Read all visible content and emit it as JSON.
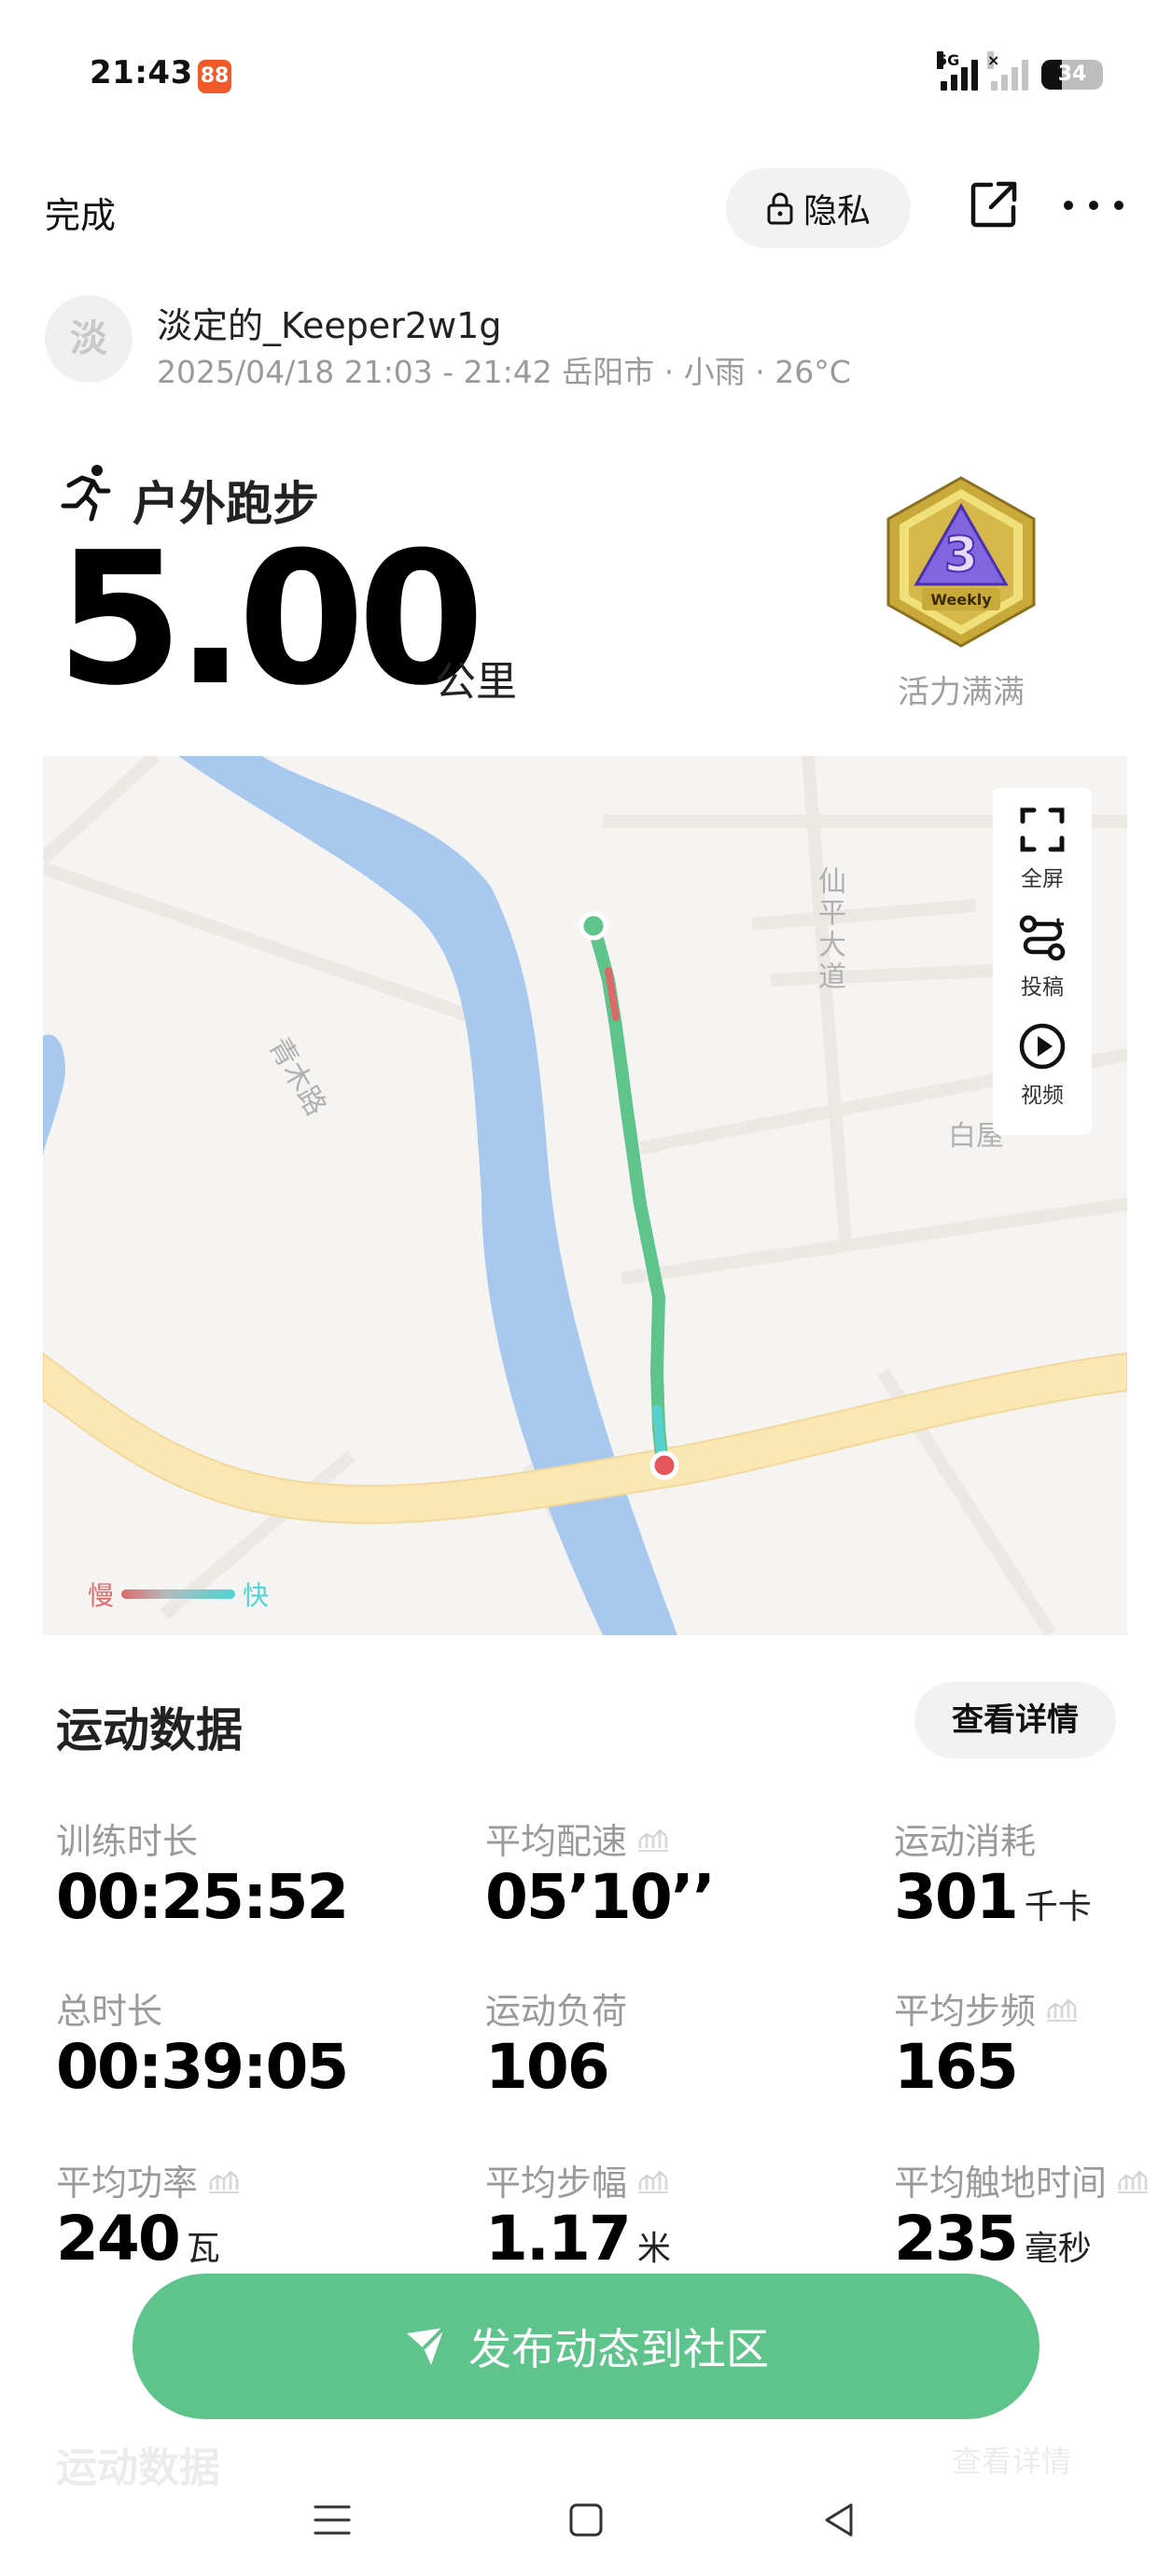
{
  "status_bar": {
    "time": "21:43",
    "app_icon_glyph": "88",
    "network_label": "5G",
    "second_sim_label": "×",
    "battery_level": "34"
  },
  "top_bar": {
    "done_label": "完成",
    "privacy_label": "隐私"
  },
  "user": {
    "avatar_char": "淡",
    "name": "淡定的_Keeper2w1g",
    "meta": "2025/04/18 21:03 - 21:42 岳阳市 · 小雨 · 26°C"
  },
  "activity": {
    "title": "户外跑步",
    "distance": "5.00",
    "distance_unit": "公里",
    "badge_text": "Weekly",
    "badge_label": "活力满满"
  },
  "map": {
    "labels": [
      "仙平大道",
      "白屋",
      "青木路"
    ],
    "controls": [
      {
        "label": "全屏",
        "icon": "fullscreen-icon"
      },
      {
        "label": "投稿",
        "icon": "route-icon"
      },
      {
        "label": "视频",
        "icon": "play-icon"
      }
    ],
    "legend_slow": "慢",
    "legend_fast": "快",
    "colors": {
      "river": "#a9c8ee",
      "road": "#fbe7b4",
      "route": "#5ec48c",
      "start": "#5ec48c",
      "end": "#e5565c"
    }
  },
  "stats": {
    "section_title": "运动数据",
    "detail_label": "查看详情",
    "items": [
      {
        "label": "训练时长",
        "value": "00:25:52",
        "unit": "",
        "chart": false
      },
      {
        "label": "平均配速",
        "value": "05’10’’",
        "unit": "",
        "chart": true
      },
      {
        "label": "运动消耗",
        "value": "301",
        "unit": "千卡",
        "chart": false
      },
      {
        "label": "总时长",
        "value": "00:39:05",
        "unit": "",
        "chart": false
      },
      {
        "label": "运动负荷",
        "value": "106",
        "unit": "",
        "chart": false
      },
      {
        "label": "平均步频",
        "value": "165",
        "unit": "",
        "chart": true
      },
      {
        "label": "平均功率",
        "value": "240",
        "unit": "瓦",
        "chart": true
      },
      {
        "label": "平均步幅",
        "value": "1.17",
        "unit": "米",
        "chart": true
      },
      {
        "label": "平均触地时间",
        "value": "235",
        "unit": "毫秒",
        "chart": true
      }
    ]
  },
  "publish": {
    "label": "发布动态到社区",
    "peek_title": "运动数据",
    "peek_detail": "查看详情"
  },
  "accent_color": "#5ec48c"
}
